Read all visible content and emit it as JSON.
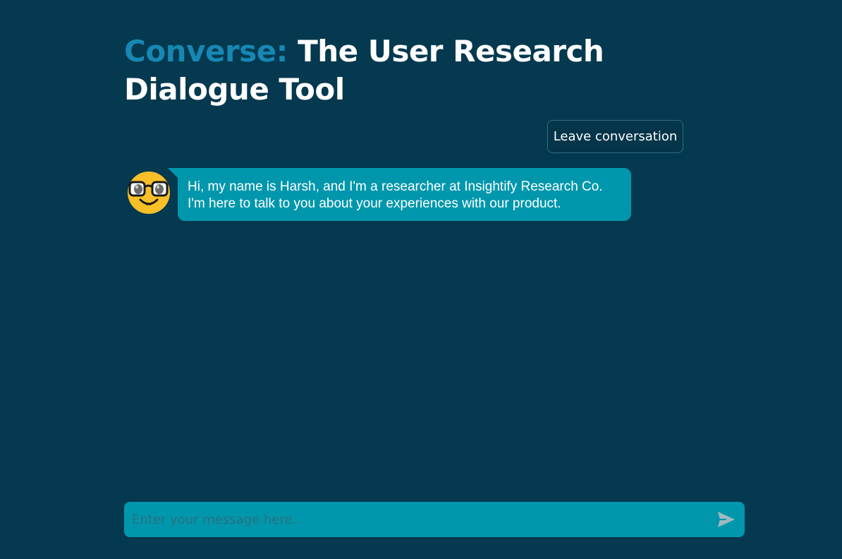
{
  "header": {
    "brand": "Converse:",
    "title": "The User Research Dialogue Tool"
  },
  "actions": {
    "leave_label": "Leave conversation"
  },
  "messages": [
    {
      "sender_icon": "nerd-face-emoji",
      "text": "Hi, my name is Harsh, and I'm a researcher at Insightify Research Co. I'm here to talk to you about your experiences with our product."
    }
  ],
  "composer": {
    "placeholder": "Enter your message here..",
    "value": "",
    "send_icon": "send-icon"
  },
  "colors": {
    "background": "#04394f",
    "brand": "#1787b3",
    "bubble": "#0097ac",
    "composer": "#0097ac",
    "avatar": "#f7c028"
  }
}
